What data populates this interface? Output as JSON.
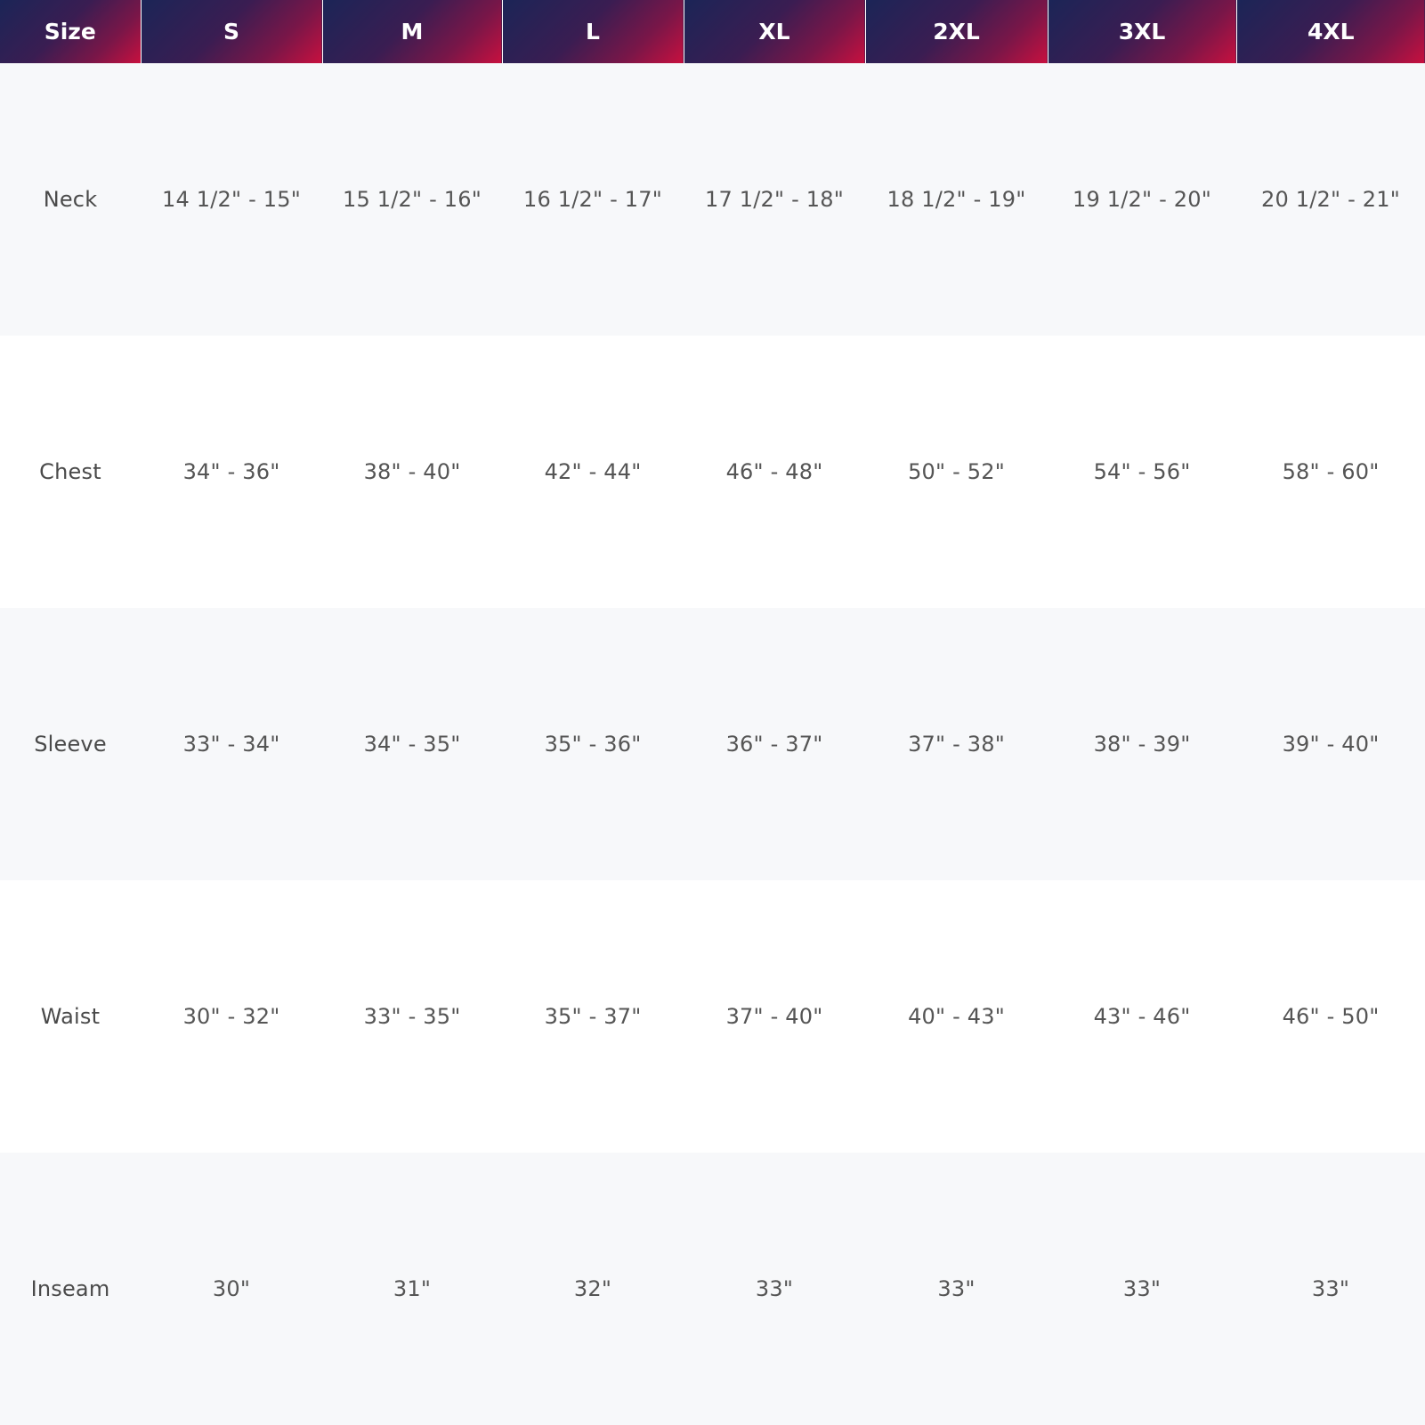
{
  "table": {
    "header": [
      "Size",
      "S",
      "M",
      "L",
      "XL",
      "2XL",
      "3XL",
      "4XL"
    ],
    "rows": [
      {
        "label": "Neck",
        "values": [
          "14 1/2\" - 15\"",
          "15 1/2\" - 16\"",
          "16 1/2\" - 17\"",
          "17 1/2\" - 18\"",
          "18 1/2\" - 19\"",
          "19 1/2\" - 20\"",
          "20 1/2\" - 21\""
        ]
      },
      {
        "label": "Chest",
        "values": [
          "34\" - 36\"",
          "38\" - 40\"",
          "42\" - 44\"",
          "46\" - 48\"",
          "50\" - 52\"",
          "54\" - 56\"",
          "58\" - 60\""
        ]
      },
      {
        "label": "Sleeve",
        "values": [
          "33\" - 34\"",
          "34\" - 35\"",
          "35\" - 36\"",
          "36\" - 37\"",
          "37\" - 38\"",
          "38\" - 39\"",
          "39\" - 40\""
        ]
      },
      {
        "label": "Waist",
        "values": [
          "30\" - 32\"",
          "33\" - 35\"",
          "35\" - 37\"",
          "37\" - 40\"",
          "40\" - 43\"",
          "43\" - 46\"",
          "46\" - 50\""
        ]
      },
      {
        "label": "Inseam",
        "values": [
          "30\"",
          "31\"",
          "32\"",
          "33\"",
          "33\"",
          "33\"",
          "33\""
        ]
      }
    ]
  },
  "colors": {
    "header_gradient_start": "#1b2557",
    "header_gradient_end": "#c8103f",
    "header_text": "#ffffff",
    "row_alt_bg": "#f7f8fa",
    "row_bg": "#ffffff",
    "cell_text": "#555555"
  }
}
